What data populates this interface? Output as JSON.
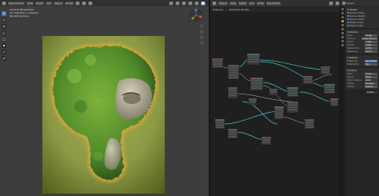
{
  "viewport": {
    "mode": "Object Mode",
    "menus": [
      "View",
      "Select",
      "Add",
      "Object"
    ],
    "transform_orientation": "Global",
    "info_lines": [
      "Camera Perspective",
      "(1) Collection | Suzanne",
      "Rendering done"
    ],
    "tools": [
      "select",
      "cursor",
      "move",
      "rotate",
      "scale",
      "transform",
      "annotate",
      "measure"
    ]
  },
  "node_editor": {
    "editor_type": "Shader Editor",
    "menus": [
      "View",
      "Select",
      "Add",
      "Node"
    ],
    "object_selector": "Object",
    "breadcrumb": [
      "Suzanne",
      "Geometry Nodes"
    ],
    "use_nodes_label": "Use Nodes"
  },
  "properties": {
    "header_label": "Layers",
    "layers": {
      "title": "Layers",
      "items": [
        {
          "label": "Scene Index",
          "checked": true
        },
        {
          "label": "Scene Depth",
          "checked": true
        },
        {
          "label": "Scene Index",
          "checked": true
        },
        {
          "label": "Mask Index",
          "checked": true
        },
        {
          "label": "Mask Index",
          "checked": true
        }
      ]
    },
    "volume": {
      "title": "Volume",
      "rows": [
        {
          "label": "Type",
          "value": "Image"
        },
        {
          "label": "Source",
          "value": "Noise Texture"
        },
        {
          "label": "Scale",
          "value": "1.000"
        },
        {
          "label": "Detail",
          "value": "2.000"
        },
        {
          "label": "Default W",
          "value": "0.000"
        },
        {
          "label": "Mapping",
          "value": "Vector"
        }
      ]
    },
    "texture": {
      "title": "Texture",
      "rows": [
        {
          "label": "Mapping",
          "value": "Generated"
        },
        {
          "label": "Extension",
          "value": "Clip"
        }
      ]
    },
    "colors": {
      "title": "Colors",
      "rows": [
        {
          "label": "Type",
          "value": "Linear"
        },
        {
          "label": "Input",
          "value": "Noise"
        },
        {
          "label": "Color Space",
          "value": "sRGB"
        },
        {
          "label": "Alpha",
          "value": "Straight"
        },
        {
          "label": "Vector",
          "value": "Default"
        }
      ]
    },
    "footer_label": "Linear"
  },
  "colors": {
    "accent": "#4772b3",
    "moss": "#4f8a2a",
    "glow": "#e0a63a",
    "background_green": "#8a9a45",
    "node_link": "#46c6c0"
  }
}
